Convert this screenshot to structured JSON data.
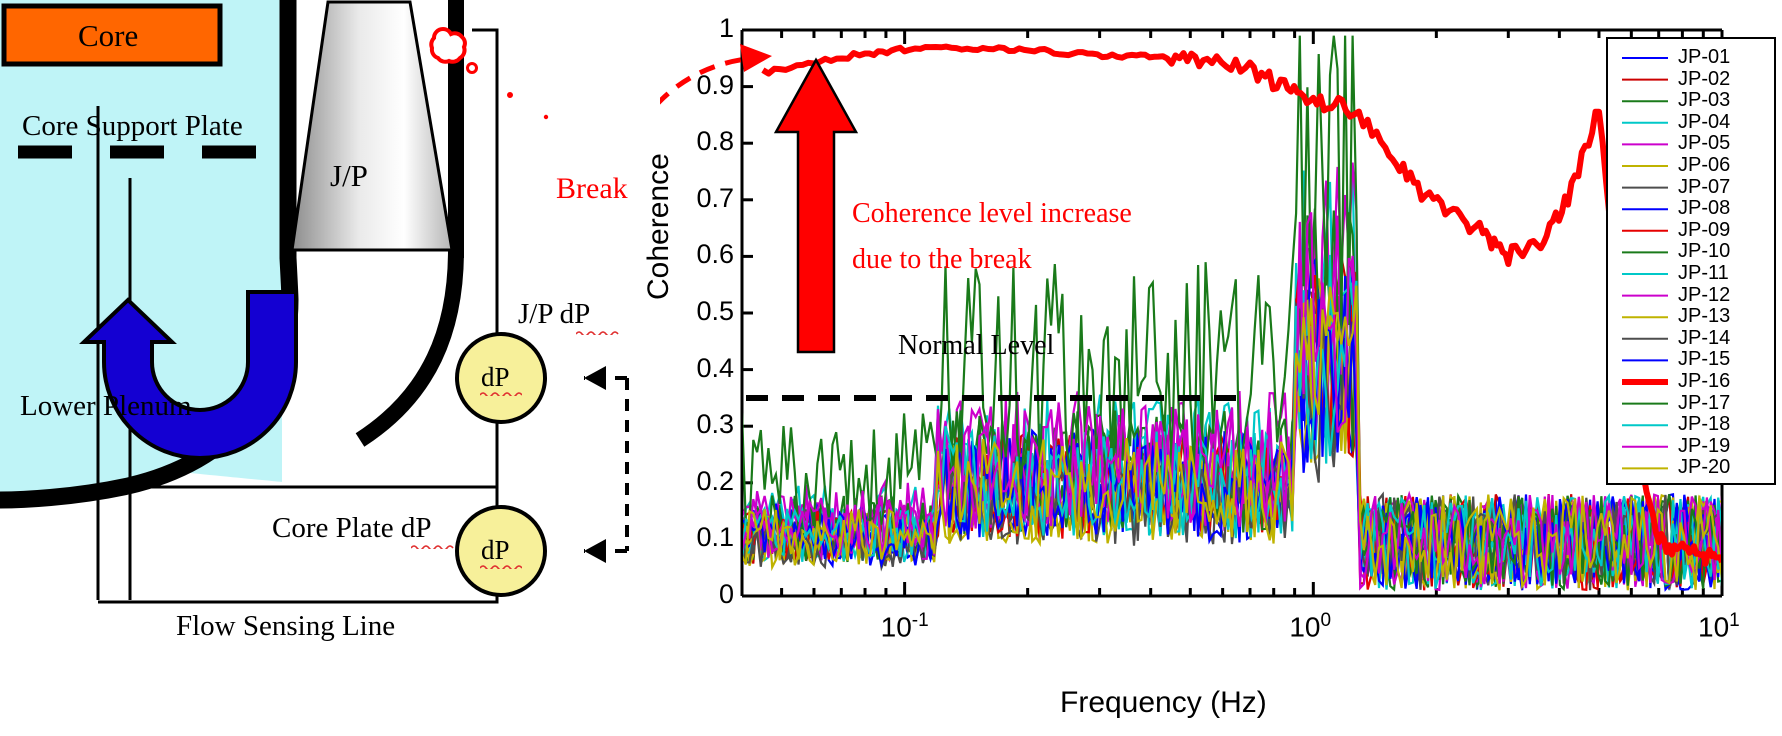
{
  "diagram": {
    "core_label": "Core",
    "core_support_plate_label": "Core Support Plate",
    "jet_pump_label": "J/P",
    "lower_plenum_label": "Lower Plenum",
    "jp_dp_label": "J/P dP",
    "core_plate_dp_label": "Core Plate dP",
    "flow_sensing_line_label": "Flow Sensing Line",
    "dp_sensor_1_label": "dP",
    "dp_sensor_2_label": "dP",
    "break_label": "Break",
    "colors": {
      "core_fill": "#ff6600",
      "plenum_fill": "#bff4f7",
      "flow_arrow": "#1400d2",
      "dp_fill": "#f7f09a",
      "break_red": "#ff0000",
      "structure_black": "#000000"
    }
  },
  "chart_data": {
    "type": "line",
    "title": "",
    "xlabel": "Frequency (Hz)",
    "ylabel": "Coherence",
    "xscale": "log",
    "xlim": [
      0.04,
      10
    ],
    "ylim": [
      0,
      1
    ],
    "xticks": [
      "10⁻¹",
      "10⁰",
      "10¹"
    ],
    "xtick_bases": [
      "10",
      "10",
      "10"
    ],
    "xtick_exponents": [
      "-1",
      "0",
      "1"
    ],
    "yticks": [
      "0",
      "0.1",
      "0.2",
      "0.3",
      "0.4",
      "0.5",
      "0.6",
      "0.7",
      "0.8",
      "0.9",
      "1"
    ],
    "grid": false,
    "legend_position": "upper-right",
    "normal_level_threshold": 0.35,
    "annotations": [
      {
        "name": "break-callout",
        "text": "Break",
        "color": "#ff0000"
      },
      {
        "name": "coherence-increase-line1",
        "text": "Coherence  level  increase",
        "color": "#ff0000"
      },
      {
        "name": "coherence-increase-line2",
        "text": "due to the break",
        "color": "#ff0000"
      },
      {
        "name": "normal-level",
        "text": "Normal Level",
        "color": "#000000"
      }
    ],
    "series": [
      {
        "name": "JP-01",
        "color": "#0000ff",
        "highlight": false,
        "peak": 0.28
      },
      {
        "name": "JP-02",
        "color": "#cc0000",
        "highlight": false,
        "peak": 0.29
      },
      {
        "name": "JP-03",
        "color": "#1a7a1a",
        "highlight": false,
        "peak": 0.31
      },
      {
        "name": "JP-04",
        "color": "#00c8c8",
        "highlight": false,
        "peak": 0.36
      },
      {
        "name": "JP-05",
        "color": "#cc00cc",
        "highlight": false,
        "peak": 0.37
      },
      {
        "name": "JP-06",
        "color": "#bfb300",
        "highlight": false,
        "peak": 0.27
      },
      {
        "name": "JP-07",
        "color": "#4d4d4d",
        "highlight": false,
        "peak": 0.26
      },
      {
        "name": "JP-08",
        "color": "#0000ff",
        "highlight": false,
        "peak": 0.3
      },
      {
        "name": "JP-09",
        "color": "#e60000",
        "highlight": false,
        "peak": 0.28
      },
      {
        "name": "JP-10",
        "color": "#1a7a1a",
        "highlight": false,
        "peak": 0.33
      },
      {
        "name": "JP-11",
        "color": "#00c8c8",
        "highlight": false,
        "peak": 0.29
      },
      {
        "name": "JP-12",
        "color": "#cc00cc",
        "highlight": false,
        "peak": 0.32
      },
      {
        "name": "JP-13",
        "color": "#bfb300",
        "highlight": false,
        "peak": 0.26
      },
      {
        "name": "JP-14",
        "color": "#4d4d4d",
        "highlight": false,
        "peak": 0.25
      },
      {
        "name": "JP-15",
        "color": "#0000ff",
        "highlight": false,
        "peak": 0.27
      },
      {
        "name": "JP-16",
        "color": "#ff0000",
        "highlight": true,
        "peak": 0.97
      },
      {
        "name": "JP-17",
        "color": "#1a7a1a",
        "highlight": false,
        "peak": 0.59
      },
      {
        "name": "JP-18",
        "color": "#00c8c8",
        "highlight": false,
        "peak": 0.3
      },
      {
        "name": "JP-19",
        "color": "#cc00cc",
        "highlight": false,
        "peak": 0.34
      },
      {
        "name": "JP-20",
        "color": "#bfb300",
        "highlight": false,
        "peak": 0.28
      }
    ],
    "highlight_series": {
      "name": "JP-16",
      "color": "#ff0000",
      "description": "Broken jet pump — coherence stays near 0.92–0.97 across low frequency and drops after 1 Hz",
      "x": [
        0.045,
        0.06,
        0.08,
        0.1,
        0.13,
        0.17,
        0.22,
        0.28,
        0.36,
        0.45,
        0.55,
        0.7,
        0.85,
        1.0,
        1.2,
        1.5,
        1.8,
        2.2,
        2.6,
        3.0,
        3.6,
        4.2,
        5.0,
        6.0,
        7.0,
        8.0,
        9.0,
        10.0
      ],
      "y": [
        0.925,
        0.945,
        0.958,
        0.966,
        0.97,
        0.968,
        0.962,
        0.957,
        0.955,
        0.95,
        0.94,
        0.93,
        0.9,
        0.88,
        0.86,
        0.8,
        0.72,
        0.68,
        0.64,
        0.6,
        0.62,
        0.7,
        0.86,
        0.3,
        0.1,
        0.08,
        0.07,
        0.06
      ]
    }
  },
  "legend": {
    "items": [
      {
        "label": "JP-01",
        "color": "#0000ff",
        "width": 2
      },
      {
        "label": "JP-02",
        "color": "#cc0000",
        "width": 2
      },
      {
        "label": "JP-03",
        "color": "#1a7a1a",
        "width": 2
      },
      {
        "label": "JP-04",
        "color": "#00c8c8",
        "width": 2
      },
      {
        "label": "JP-05",
        "color": "#cc00cc",
        "width": 2
      },
      {
        "label": "JP-06",
        "color": "#bfb300",
        "width": 2
      },
      {
        "label": "JP-07",
        "color": "#4d4d4d",
        "width": 2
      },
      {
        "label": "JP-08",
        "color": "#0000ff",
        "width": 2
      },
      {
        "label": "JP-09",
        "color": "#e60000",
        "width": 2
      },
      {
        "label": "JP-10",
        "color": "#1a7a1a",
        "width": 2
      },
      {
        "label": "JP-11",
        "color": "#00c8c8",
        "width": 2
      },
      {
        "label": "JP-12",
        "color": "#cc00cc",
        "width": 2
      },
      {
        "label": "JP-13",
        "color": "#bfb300",
        "width": 2
      },
      {
        "label": "JP-14",
        "color": "#4d4d4d",
        "width": 2
      },
      {
        "label": "JP-15",
        "color": "#0000ff",
        "width": 2
      },
      {
        "label": "JP-16",
        "color": "#ff0000",
        "width": 6
      },
      {
        "label": "JP-17",
        "color": "#1a7a1a",
        "width": 2
      },
      {
        "label": "JP-18",
        "color": "#00c8c8",
        "width": 2
      },
      {
        "label": "JP-19",
        "color": "#cc00cc",
        "width": 2
      },
      {
        "label": "JP-20",
        "color": "#bfb300",
        "width": 2
      }
    ]
  }
}
